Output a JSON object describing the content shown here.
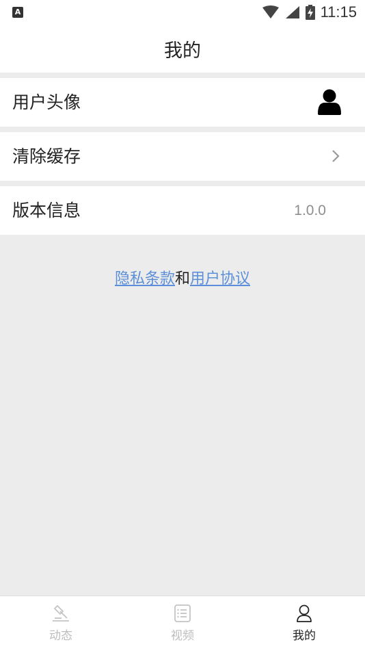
{
  "status_bar": {
    "left_badge": "A",
    "time": "11:15"
  },
  "header": {
    "title": "我的"
  },
  "rows": {
    "avatar": {
      "label": "用户头像"
    },
    "cache": {
      "label": "清除缓存"
    },
    "version": {
      "label": "版本信息",
      "value": "1.0.0"
    }
  },
  "links": {
    "privacy": "隐私条款",
    "joiner": "和",
    "agreement": "用户协议"
  },
  "tabs": [
    {
      "label": "动态",
      "icon": "hammer-icon",
      "active": false
    },
    {
      "label": "视频",
      "icon": "list-icon",
      "active": false
    },
    {
      "label": "我的",
      "icon": "user-icon",
      "active": true
    }
  ],
  "colors": {
    "link": "#5b8fd9",
    "background": "#ececec",
    "inactive_tab": "#bdbdbd"
  }
}
